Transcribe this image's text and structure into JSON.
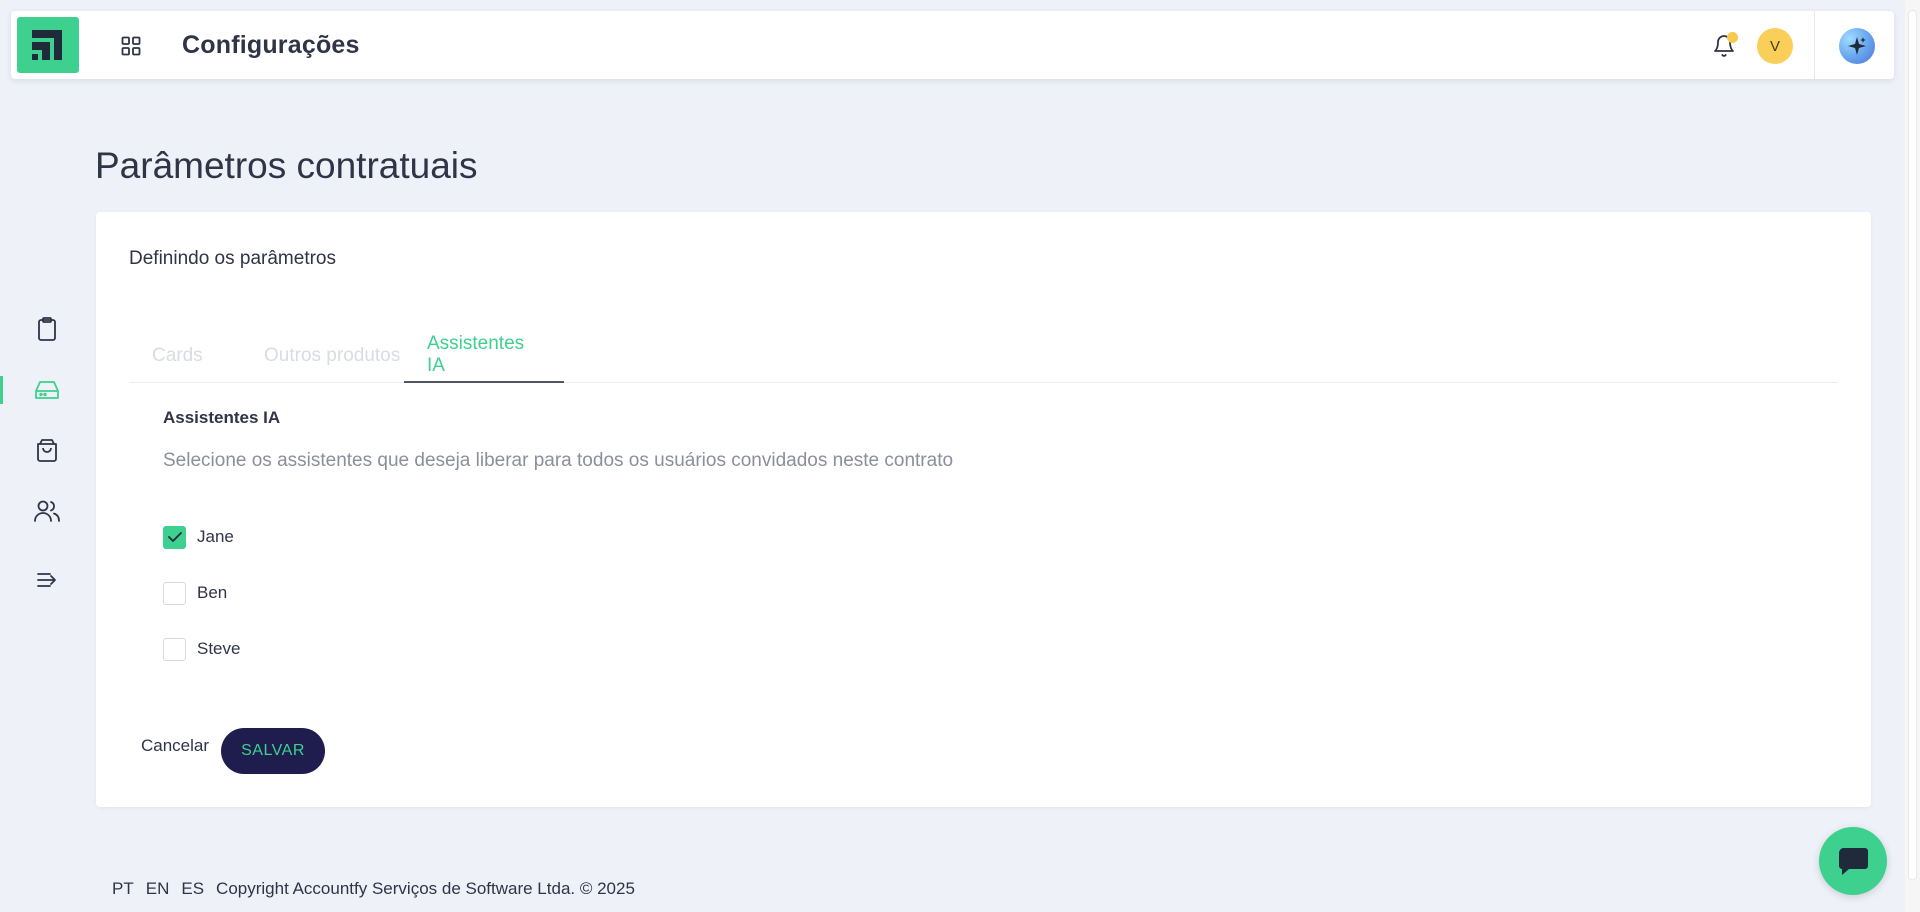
{
  "header": {
    "title": "Configurações",
    "avatar_initial": "V",
    "logo_icon": "accountfy-logo-icon",
    "apps_icon": "grid-apps-icon",
    "bell_icon": "bell-icon",
    "ai_icon": "sparkles-icon"
  },
  "sidebar": {
    "items": [
      {
        "icon": "clipboard-icon",
        "active": false
      },
      {
        "icon": "inbox-tray-icon",
        "active": true
      },
      {
        "icon": "shopping-bag-icon",
        "active": false
      },
      {
        "icon": "users-icon",
        "active": false
      },
      {
        "icon": "list-arrow-icon",
        "active": false
      }
    ]
  },
  "page": {
    "title": "Parâmetros contratuais"
  },
  "card": {
    "subtitle": "Definindo os parâmetros",
    "tabs": [
      {
        "label": "Cards",
        "active": false
      },
      {
        "label": "Outros produtos",
        "active": false
      },
      {
        "label": "Assistentes IA",
        "active": true
      }
    ],
    "section": {
      "title": "Assistentes IA",
      "description": "Selecione os assistentes que deseja liberar para todos os usuários convidados neste contrato",
      "options": [
        {
          "label": "Jane",
          "checked": true
        },
        {
          "label": "Ben",
          "checked": false
        },
        {
          "label": "Steve",
          "checked": false
        }
      ]
    },
    "actions": {
      "cancel_label": "Cancelar",
      "save_label": "SALVAR"
    }
  },
  "footer": {
    "languages": [
      "PT",
      "EN",
      "ES"
    ],
    "copyright": "Copyright Accountfy Serviços de Software Ltda. © 2025"
  },
  "colors": {
    "accent_green": "#3ed08f",
    "navy": "#1f1d4d",
    "background": "#eef1f8",
    "avatar_yellow": "#f9cf5a"
  }
}
